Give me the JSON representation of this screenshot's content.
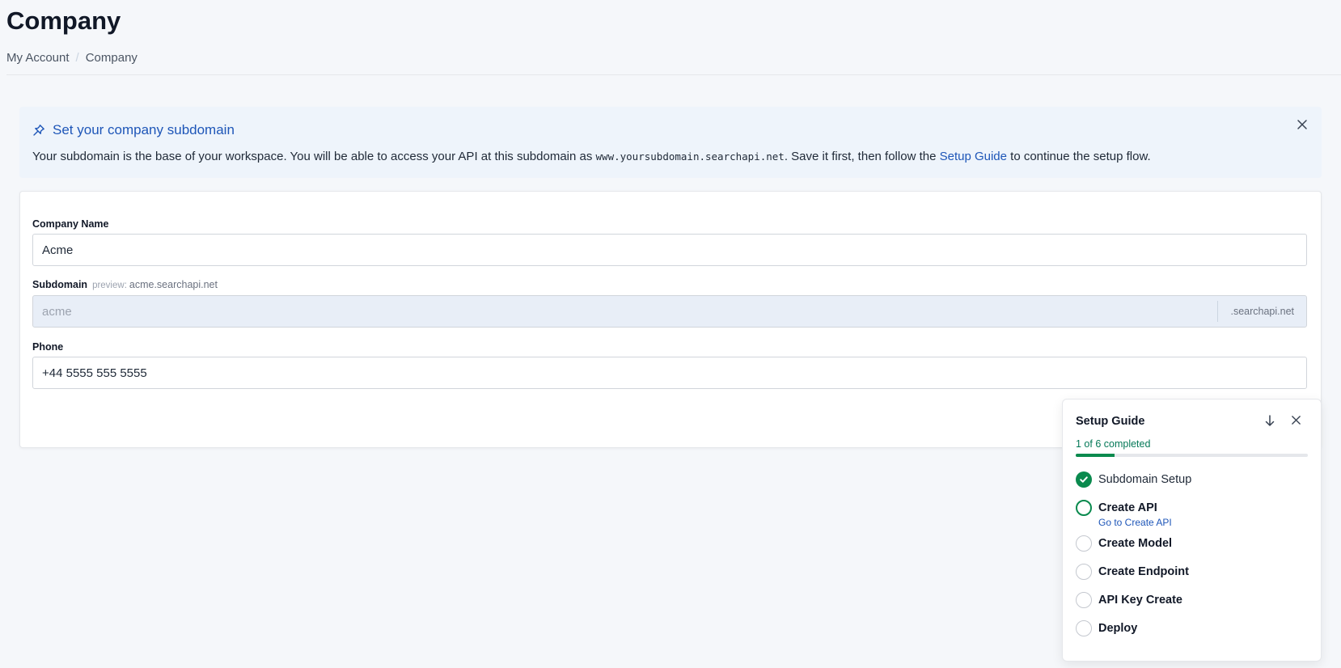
{
  "page": {
    "title": "Company",
    "breadcrumb": [
      "My Account",
      "Company"
    ]
  },
  "banner": {
    "title": "Set your company subdomain",
    "text_before": "Your subdomain is the base of your workspace. You will be able to access your API at this subdomain as ",
    "code": "www.yoursubdomain.searchapi.net",
    "text_middle": ". Save it first, then follow the ",
    "link": "Setup Guide",
    "text_after": " to continue the setup flow.",
    "icons": {
      "title": "pin-icon",
      "close": "close-icon"
    }
  },
  "form": {
    "company_name": {
      "label": "Company Name",
      "value": "Acme"
    },
    "subdomain": {
      "label": "Subdomain",
      "preview_label": "preview:",
      "preview_value": "acme.searchapi.net",
      "placeholder": "acme",
      "suffix": ".searchapi.net"
    },
    "phone": {
      "label": "Phone",
      "value": "+44 5555 555 5555"
    }
  },
  "setup_guide": {
    "title": "Setup Guide",
    "progress_text": "1 of 6 completed",
    "progress_fraction": 0.1667,
    "icons": {
      "collapse": "arrow-down-icon",
      "close": "close-icon"
    },
    "steps": [
      {
        "label": "Subdomain Setup",
        "status": "done"
      },
      {
        "label": "Create API",
        "status": "active",
        "link": "Go to Create API"
      },
      {
        "label": "Create Model",
        "status": "todo"
      },
      {
        "label": "Create Endpoint",
        "status": "todo"
      },
      {
        "label": "API Key Create",
        "status": "todo"
      },
      {
        "label": "Deploy",
        "status": "todo"
      }
    ]
  },
  "colors": {
    "accent_blue": "#1e56b8",
    "success_green": "#0a8a4e",
    "banner_bg": "#eef4fb",
    "page_bg": "#f5f7fa"
  }
}
